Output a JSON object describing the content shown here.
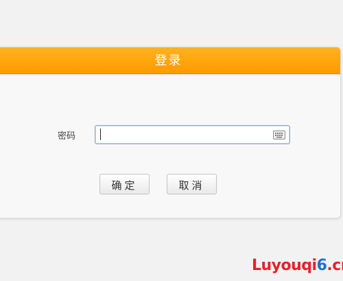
{
  "dialog": {
    "title": "登录",
    "password_label": "密码",
    "password_value": "",
    "ok_label": "确定",
    "cancel_label": "取消"
  },
  "colors": {
    "header": "#ff9f0a",
    "background": "#f2f2f2"
  },
  "icons": {
    "keyboard": "keyboard-icon"
  },
  "watermark": {
    "part1": "Luyouqi",
    "part2": "6",
    "part3": ".cn"
  }
}
